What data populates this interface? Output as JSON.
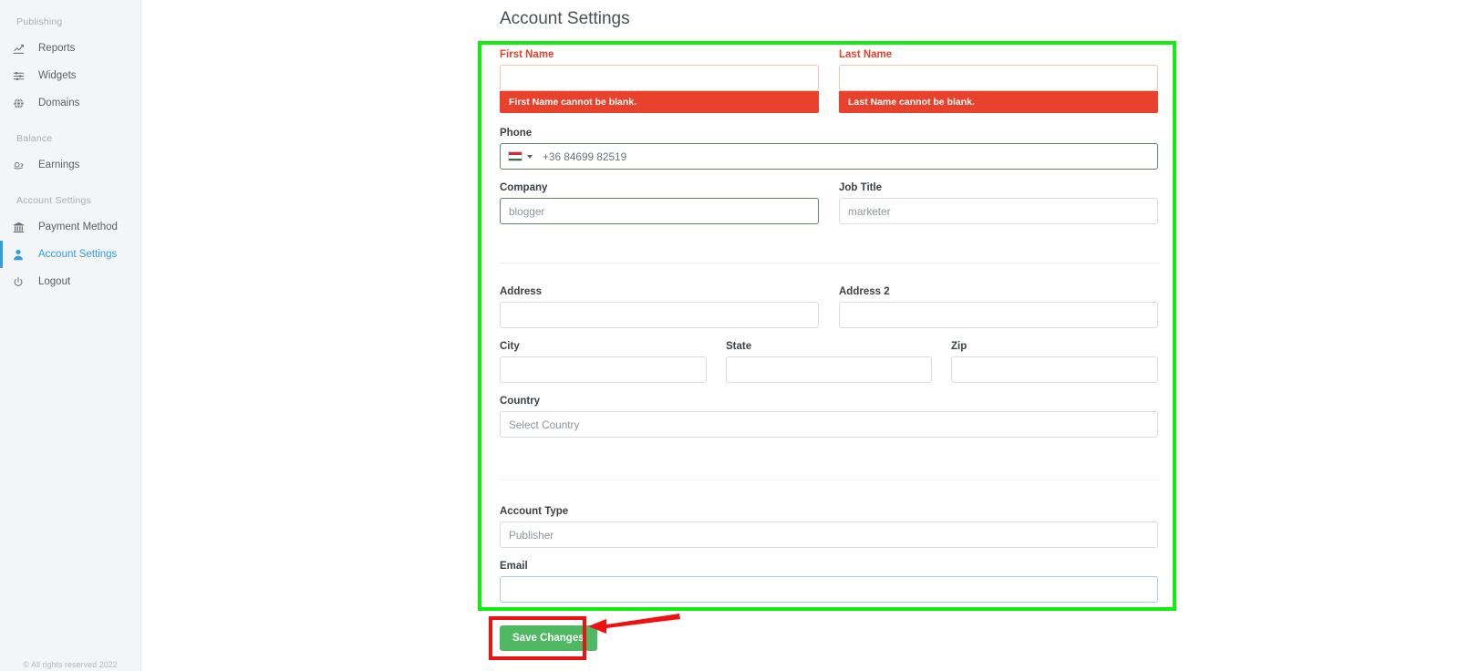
{
  "sidebar": {
    "sections": [
      {
        "title": "Publishing",
        "items": [
          {
            "label": "Reports",
            "icon": "chart-line-icon",
            "active": false
          },
          {
            "label": "Widgets",
            "icon": "sliders-icon",
            "active": false
          },
          {
            "label": "Domains",
            "icon": "globe-icon",
            "active": false
          }
        ]
      },
      {
        "title": "Balance",
        "items": [
          {
            "label": "Earnings",
            "icon": "hand-holding-coin-icon",
            "active": false
          }
        ]
      },
      {
        "title": "Account Settings",
        "items": [
          {
            "label": "Payment Method",
            "icon": "bank-icon",
            "active": false
          },
          {
            "label": "Account Settings",
            "icon": "user-icon",
            "active": true
          },
          {
            "label": "Logout",
            "icon": "power-icon",
            "active": false
          }
        ]
      }
    ],
    "footer": "© All rights reserved 2022"
  },
  "page": {
    "title": "Account Settings"
  },
  "form": {
    "first_name": {
      "label": "First Name",
      "value": "",
      "placeholder": "",
      "error": "First Name cannot be blank.",
      "state": "error"
    },
    "last_name": {
      "label": "Last Name",
      "value": "",
      "placeholder": "",
      "error": "Last Name cannot be blank.",
      "state": "error"
    },
    "phone": {
      "label": "Phone",
      "value": "+36 84699 82519",
      "flag": "hungary-flag-icon",
      "state": "valid"
    },
    "company": {
      "label": "Company",
      "value": "",
      "placeholder": "blogger",
      "state": "valid"
    },
    "job_title": {
      "label": "Job Title",
      "value": "",
      "placeholder": "marketer",
      "state": "default"
    },
    "address": {
      "label": "Address",
      "value": "",
      "placeholder": "",
      "state": "default"
    },
    "address2": {
      "label": "Address 2",
      "value": "",
      "placeholder": "",
      "state": "default"
    },
    "city": {
      "label": "City",
      "value": "",
      "placeholder": "",
      "state": "default"
    },
    "state": {
      "label": "State",
      "value": "",
      "placeholder": "",
      "state": "default"
    },
    "zip": {
      "label": "Zip",
      "value": "",
      "placeholder": "",
      "state": "default"
    },
    "country": {
      "label": "Country",
      "value": "",
      "placeholder": "Select Country",
      "state": "default"
    },
    "account_type": {
      "label": "Account Type",
      "value": "",
      "placeholder": "Publisher",
      "state": "default"
    },
    "email": {
      "label": "Email",
      "value": "",
      "placeholder": "",
      "state": "focused"
    },
    "save_label": "Save Changes"
  },
  "annotations": {
    "green_box_color": "#13ec13",
    "red_box_color": "#ee1111",
    "arrow_color": "#ee1111",
    "error_color": "#e8412c",
    "accent_color": "#2f9fe0",
    "save_color": "#4eb863"
  }
}
